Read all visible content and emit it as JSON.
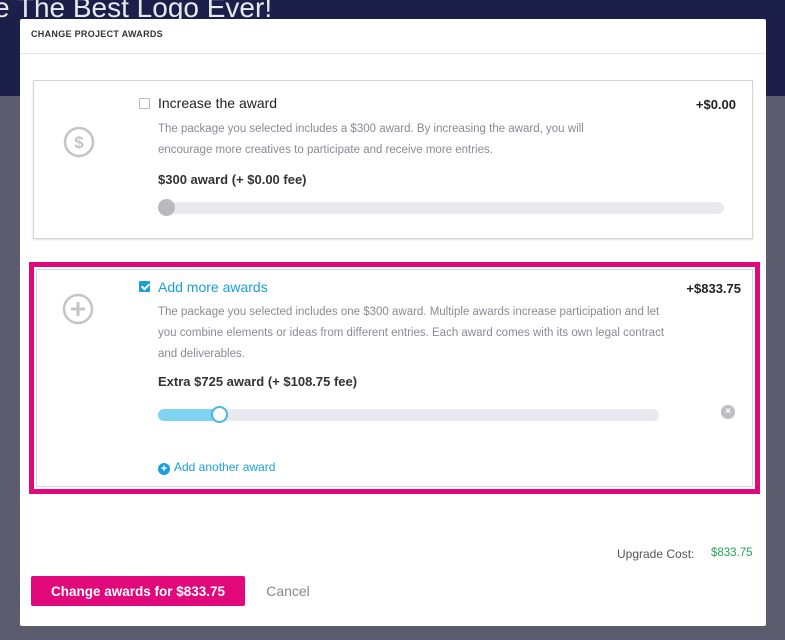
{
  "background": {
    "page_title": "e The Best Logo Ever!"
  },
  "modal": {
    "title": "CHANGE PROJECT AWARDS",
    "options": [
      {
        "icon": "dollar-circle-icon",
        "checked": false,
        "title": "Increase the award",
        "amount": "+$0.00",
        "description": "The package you selected includes a $300 award. By increasing the award, you will encourage more creatives to participate and receive more entries.",
        "slider_label": "$300 award (+ $0.00 fee)",
        "slider_value": 0
      },
      {
        "icon": "plus-circle-icon",
        "checked": true,
        "title": "Add more awards",
        "amount": "+$833.75",
        "description": "The package you selected includes one $300 award. Multiple awards increase participation and let you combine elements or ideas from different entries. Each award comes with its own legal contract and deliverables.",
        "slider_label": "Extra $725 award (+ $108.75 fee)",
        "slider_value": 0.12,
        "add_another_label": "Add another award"
      }
    ],
    "upgrade_cost_label": "Upgrade Cost:",
    "upgrade_cost_value": "$833.75",
    "primary_button": "Change awards for $833.75",
    "cancel_button": "Cancel"
  },
  "colors": {
    "accent": "#e0087a",
    "link": "#1a9fdc",
    "success": "#22a35a"
  }
}
